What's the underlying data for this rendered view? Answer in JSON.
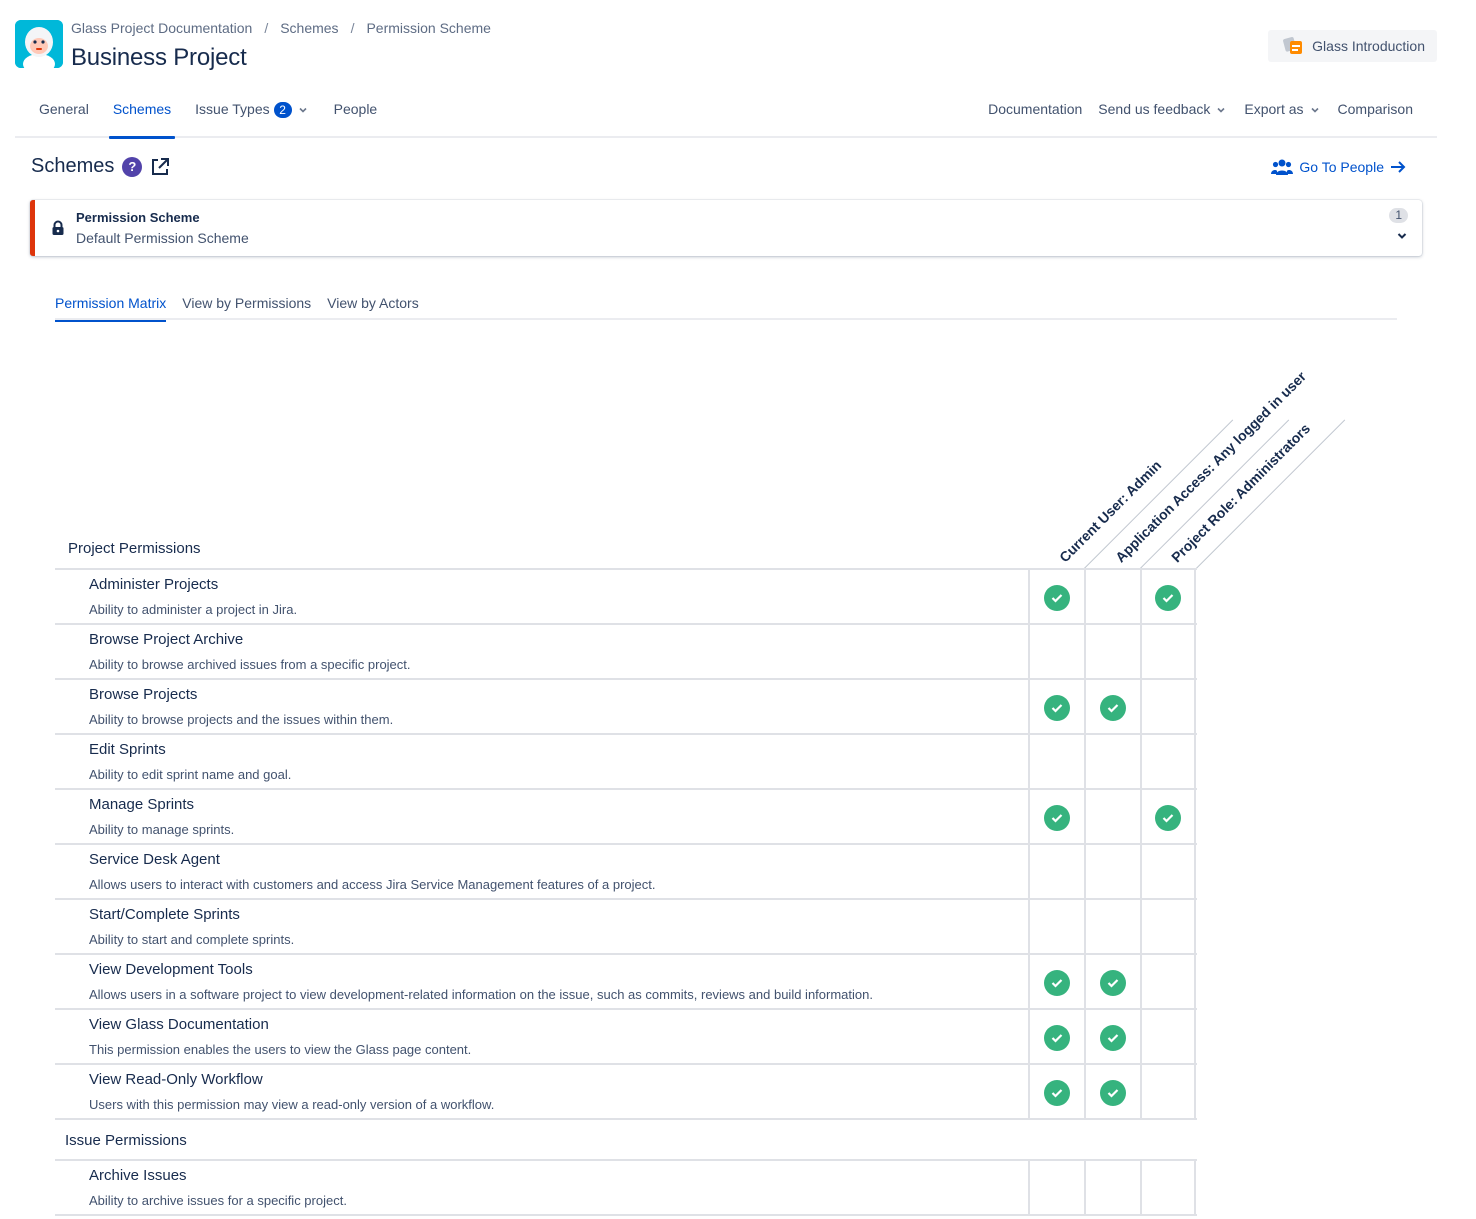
{
  "breadcrumb": [
    "Glass Project Documentation",
    "Schemes",
    "Permission Scheme"
  ],
  "project_title": "Business Project",
  "glass_intro_label": "Glass Introduction",
  "nav": {
    "tabs": [
      {
        "label": "General",
        "active": false
      },
      {
        "label": "Schemes",
        "active": true
      },
      {
        "label": "Issue Types",
        "active": false,
        "badge": "2"
      },
      {
        "label": "People",
        "active": false
      }
    ],
    "right": [
      {
        "label": "Documentation"
      },
      {
        "label": "Send us feedback"
      },
      {
        "label": "Export as"
      },
      {
        "label": "Comparison"
      }
    ]
  },
  "page_title": "Schemes",
  "go_to_people": "Go To People",
  "scheme_card": {
    "title": "Permission Scheme",
    "subtitle": "Default Permission Scheme",
    "count": "1"
  },
  "subtabs": [
    {
      "label": "Permission Matrix",
      "active": true
    },
    {
      "label": "View by Permissions",
      "active": false
    },
    {
      "label": "View by Actors",
      "active": false
    }
  ],
  "columns": [
    "Current User: Admin",
    "Application Access: Any logged in user",
    "Project Role: Administrators"
  ],
  "sections": [
    {
      "title": "Project Permissions",
      "rows": [
        {
          "name": "Administer Projects",
          "desc": "Ability to administer a project in Jira.",
          "checks": [
            true,
            false,
            true
          ]
        },
        {
          "name": "Browse Project Archive",
          "desc": "Ability to browse archived issues from a specific project.",
          "checks": [
            false,
            false,
            false
          ]
        },
        {
          "name": "Browse Projects",
          "desc": "Ability to browse projects and the issues within them.",
          "checks": [
            true,
            true,
            false
          ]
        },
        {
          "name": "Edit Sprints",
          "desc": "Ability to edit sprint name and goal.",
          "checks": [
            false,
            false,
            false
          ]
        },
        {
          "name": "Manage Sprints",
          "desc": "Ability to manage sprints.",
          "checks": [
            true,
            false,
            true
          ]
        },
        {
          "name": "Service Desk Agent",
          "desc": "Allows users to interact with customers and access Jira Service Management features of a project.",
          "checks": [
            false,
            false,
            false
          ]
        },
        {
          "name": "Start/Complete Sprints",
          "desc": "Ability to start and complete sprints.",
          "checks": [
            false,
            false,
            false
          ]
        },
        {
          "name": "View Development Tools",
          "desc": "Allows users in a software project to view development-related information on the issue, such as commits, reviews and build information.",
          "checks": [
            true,
            true,
            false
          ]
        },
        {
          "name": "View Glass Documentation",
          "desc": "This permission enables the users to view the Glass page content.",
          "checks": [
            true,
            true,
            false
          ]
        },
        {
          "name": "View Read-Only Workflow",
          "desc": "Users with this permission may view a read-only version of a workflow.",
          "checks": [
            true,
            true,
            false
          ]
        }
      ]
    },
    {
      "title": "Issue Permissions",
      "rows": [
        {
          "name": "Archive Issues",
          "desc": "Ability to archive issues for a specific project.",
          "checks": [
            false,
            false,
            false
          ]
        }
      ]
    }
  ],
  "colors": {
    "accent": "#0052cc",
    "check": "#36b37e",
    "card_stripe": "#de350b",
    "help": "#5243aa"
  }
}
